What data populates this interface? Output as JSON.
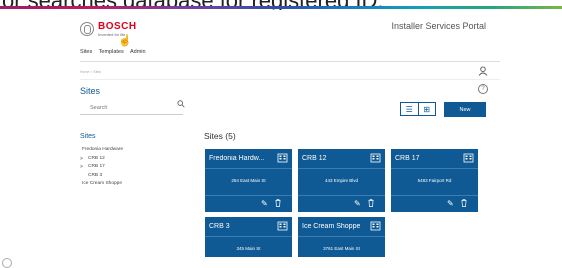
{
  "overlay_caption": "or searches database for registered ID.",
  "brand": {
    "name": "BOSCH",
    "tagline": "Invented for life"
  },
  "portal_title": "Installer Services Portal",
  "topnav": [
    "Sites",
    "Templates",
    "Admin"
  ],
  "breadcrumb": {
    "home": "Home",
    "sep": ">",
    "current": "Sites"
  },
  "page_title": "Sites",
  "search": {
    "placeholder": "Search"
  },
  "new_button": "New",
  "tree": {
    "title": "Sites",
    "items": [
      {
        "label": "Fredonia Hardware",
        "caret": ""
      },
      {
        "label": "CRB 12",
        "caret": ">"
      },
      {
        "label": "CRB 17",
        "caret": ">"
      },
      {
        "label": "CRB 3",
        "caret": ""
      },
      {
        "label": "Ice Cream Shoppe",
        "caret": ""
      }
    ]
  },
  "sites_heading": "Sites (5)",
  "cards": [
    {
      "title": "Fredonia Hardw...",
      "address": "254 East Main St"
    },
    {
      "title": "CRB 12",
      "address": "443 Empire Blvd"
    },
    {
      "title": "CRB 17",
      "address": "5483 Fairport Rd"
    },
    {
      "title": "CRB 3",
      "address": "345 Main St"
    },
    {
      "title": "Ice Cream Shoppe",
      "address": "3761 East Main St"
    }
  ],
  "colors": {
    "accent": "#0f5a94",
    "brand": "#e2001a"
  },
  "icons": {
    "search": "search-icon",
    "user": "user-icon",
    "help": "help-icon",
    "list_view": "list-view-icon",
    "grid_view": "grid-view-icon",
    "building": "building-icon",
    "edit": "edit-icon",
    "trash": "trash-icon"
  }
}
